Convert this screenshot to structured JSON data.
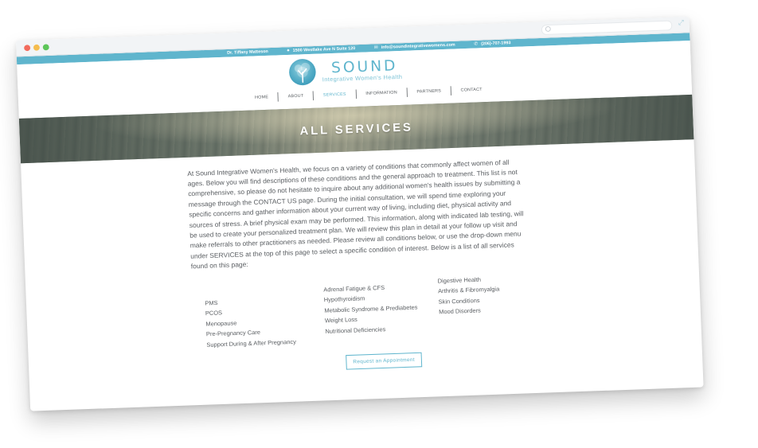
{
  "topbar": {
    "name": "Dr. Tiffany Matteson",
    "address": "1500 Westlake Ave N Suite 120",
    "email": "info@soundintegrativewomens.com",
    "phone": "(206)-707-1993"
  },
  "logo": {
    "title": "SOUND",
    "subtitle": "Integrative Women's Health"
  },
  "nav": {
    "items": [
      "HOME",
      "ABOUT",
      "SERVICES",
      "INFORMATION",
      "PARTNERS",
      "CONTACT"
    ],
    "active": "SERVICES"
  },
  "hero": {
    "title": "ALL SERVICES"
  },
  "intro": {
    "text": "At Sound Integrative Women's Health, we focus on a variety of conditions that commonly affect women of all ages. Below you will find descriptions of these conditions and the general approach to treatment. This list is not comprehensive, so please do not hesitate to inquire about any additional women's health issues by submitting a message through the CONTACT US page. During the initial consultation, we will spend time exploring your specific concerns and gather information about your current way of living, including diet, physical activity and sources of stress. A brief physical exam may be performed. This information, along with indicated lab testing, will be used to create your personalized treatment plan. We will review this plan in detail at your follow up visit and make referrals to other practitioners as needed. Please review all conditions below, or use the drop-down menu under SERVICES at the top of this page to select a specific condition of interest. Below is a list of all services found on this page:"
  },
  "services": {
    "col1": [
      "PMS",
      "PCOS",
      "Menopause",
      "Pre-Pregnancy Care",
      "Support During & After Pregnancy"
    ],
    "col2": [
      "Adrenal Fatigue & CFS",
      "Hypothyroidism",
      "Metabolic Syndrome & Prediabetes",
      "Weight Loss",
      "Nutritional Deficiencies"
    ],
    "col3": [
      "Digestive Health",
      "Arthritis & Fibromyalgia",
      "Skin Conditions",
      "Mood Disorders"
    ]
  },
  "cta": {
    "label": "Request an Appointment"
  },
  "colors": {
    "brand": "#5fb5cd",
    "text": "#5a5e62"
  }
}
